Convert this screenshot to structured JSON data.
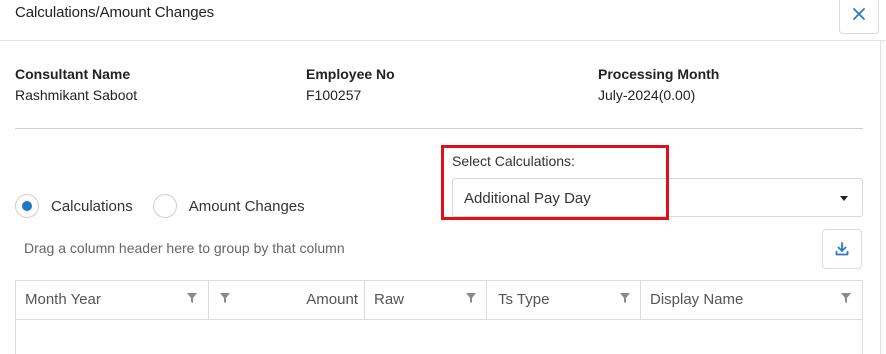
{
  "dialog": {
    "title": "Calculations/Amount Changes",
    "close_icon": "close-icon"
  },
  "info": {
    "consultant_label": "Consultant Name",
    "consultant_value": "Rashmikant Saboot",
    "employee_label": "Employee No",
    "employee_value": "F100257",
    "month_label": "Processing Month",
    "month_value": "July-2024(0.00)"
  },
  "select": {
    "label": "Select Calculations:",
    "value": "Additional Pay Day"
  },
  "radios": [
    {
      "label": "Calculations",
      "selected": true
    },
    {
      "label": "Amount Changes",
      "selected": false
    }
  ],
  "grid": {
    "group_hint": "Drag a column header here to group by that column",
    "columns": [
      "Month Year",
      "Amount",
      "Raw",
      "Ts Type",
      "Display Name"
    ]
  },
  "colors": {
    "accent": "#1f77c9",
    "highlight": "#e0101a"
  }
}
